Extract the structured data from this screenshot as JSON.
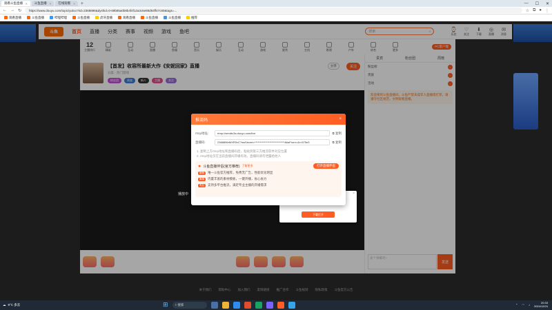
{
  "browser": {
    "tabs": [
      {
        "label": "观看斗鱼直播"
      },
      {
        "label": "斗鱼直播"
      },
      {
        "label": "在线观看"
      }
    ],
    "url": "https://www.douyu.com/topic/yuloo?rid=2368896&dyshid=0-69b85a0b8b4f4f12a3c6e88d93ff47c80&tags=..."
  },
  "bookmarks": [
    "观看直播",
    "斗鱼直播",
    "哔哩哔哩",
    "斗鱼直播",
    "虎牙直播",
    "观看直播",
    "斗鱼直播",
    "斗鱼直播",
    "推荐"
  ],
  "site": {
    "logo": "斗鱼",
    "nav": [
      "首页",
      "直播",
      "分类",
      "赛事",
      "视频",
      "游戏",
      "鱼吧"
    ],
    "search_placeholder": "搜索",
    "top_icons": [
      {
        "glyph": "⌚",
        "label": "历史"
      },
      {
        "glyph": "♡",
        "label": "关注"
      },
      {
        "glyph": "⬇",
        "label": "下载"
      },
      {
        "glyph": "◎",
        "label": "直播"
      },
      {
        "glyph": "✉",
        "label": "消息"
      }
    ]
  },
  "category_bar": {
    "rank_value": "12",
    "rank_label": "主播排行",
    "categories": [
      "精彩",
      "互动",
      "直播",
      "鱼塘",
      "音乐",
      "娱乐",
      "互动",
      "游戏",
      "星秀",
      "主机",
      "影视",
      "户外",
      "综合",
      "更多"
    ],
    "pc_button": "PC客户端"
  },
  "room": {
    "title": "【首发】收容所最新大作《安妮回家》直播",
    "meta": "分类 · 热门游戏",
    "follow": "关注",
    "share": "分享",
    "badges": [
      "粉丝团",
      "贵族",
      "新人",
      "主播",
      "关注"
    ]
  },
  "sidebar": {
    "tabs": [
      "贵宾",
      "粉丝团",
      "周榜"
    ],
    "rows": [
      "粉丝榜",
      "贵族",
      "活动"
    ],
    "notice": "欢迎来到斗鱼直播间，斗鱼严禁未成年人直播或打赏，请遵守社区规范，文明观看直播。",
    "input_placeholder": "发个弹幕吧~",
    "send": "发送"
  },
  "modal": {
    "title": "推流码",
    "close": "×",
    "rtmp_label": "rtmp地址:",
    "rtmp_value": "rtmp://sendtc3a.douyu.com/live",
    "key_label": "直播码:",
    "key_value": "2368896rMXR0vC?wsSecret=****************************&tiaFrom=&r=575e3",
    "copy": "复制",
    "tips": [
      "1. 复制上方rtmp地址和直播码后，粘贴到第三方推流软件对应位置",
      "2. rtmp地址仅在当前直播间开播有效，直播码请勿泄露给他人"
    ],
    "promo_title": "斗鱼直播伴侣(官方推荐)",
    "promo_more": "了解更多",
    "promo_button": "打开直播伴侣",
    "promo_lines": [
      {
        "tag": "推荐",
        "text": "唯一斗鱼官方推荐，免费无广告，性能优化明显"
      },
      {
        "tag": "简单",
        "text": "内置丰富的素材模板，一键开播，省心省力"
      },
      {
        "tag": "专业",
        "text": "支持多平台推流，满足专业主播的开播需求"
      }
    ]
  },
  "popup2": {
    "ok": "下载打开"
  },
  "side_hint": "播放中",
  "footer_links": [
    "关于我们",
    "帮助中心",
    "加入我们",
    "友情链接",
    "推广合作",
    "斗鱼规则",
    "隐私政策",
    "斗鱼官方公告"
  ],
  "taskbar": {
    "weather": "9°C 多云",
    "search": "搜索",
    "time": "20:33",
    "date": "2024/12/24"
  }
}
